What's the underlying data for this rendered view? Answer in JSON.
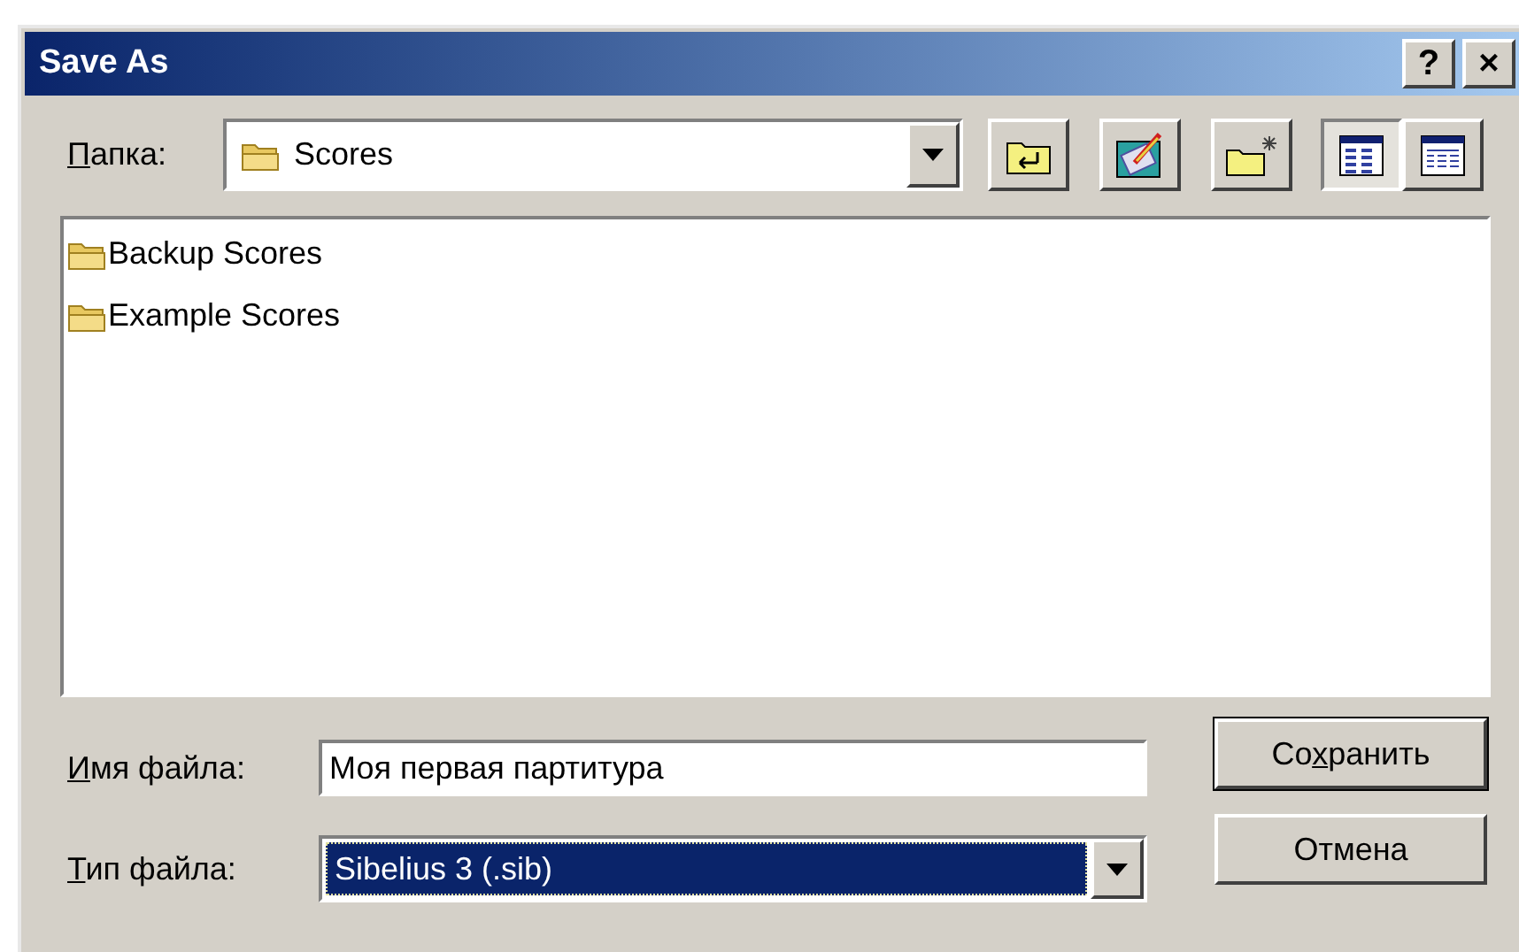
{
  "window": {
    "title": "Save As",
    "title_buttons": [
      "?",
      "×"
    ]
  },
  "folder": {
    "label": [
      {
        "text": "П",
        "underlined": true
      },
      {
        "text": "апка:",
        "underlined": false
      }
    ],
    "value": "Scores"
  },
  "toolbar": [
    {
      "kind": "up",
      "selected": false
    },
    {
      "kind": "desktop",
      "selected": false
    },
    {
      "kind": "new-folder",
      "selected": false
    },
    {
      "kind": "list-view",
      "selected": true
    },
    {
      "kind": "details-view",
      "selected": false
    }
  ],
  "files": [
    {
      "name": "Backup Scores"
    },
    {
      "name": "Example Scores"
    }
  ],
  "file_name": {
    "label": [
      {
        "text": "И",
        "underlined": true
      },
      {
        "text": "мя файла:",
        "underlined": false
      }
    ],
    "value": "Моя первая партитура"
  },
  "file_type": {
    "label": [
      {
        "text": "Т",
        "underlined": true
      },
      {
        "text": "ип файла:",
        "underlined": false
      }
    ],
    "value": "Sibelius 3 (.sib)"
  },
  "buttons": [
    {
      "label": [
        {
          "text": "Со",
          "underlined": false
        },
        {
          "text": "х",
          "underlined": true
        },
        {
          "text": "ранить",
          "underlined": false
        }
      ],
      "default": true
    },
    {
      "label": [
        {
          "text": "Отмена",
          "underlined": false
        }
      ],
      "default": false
    }
  ]
}
